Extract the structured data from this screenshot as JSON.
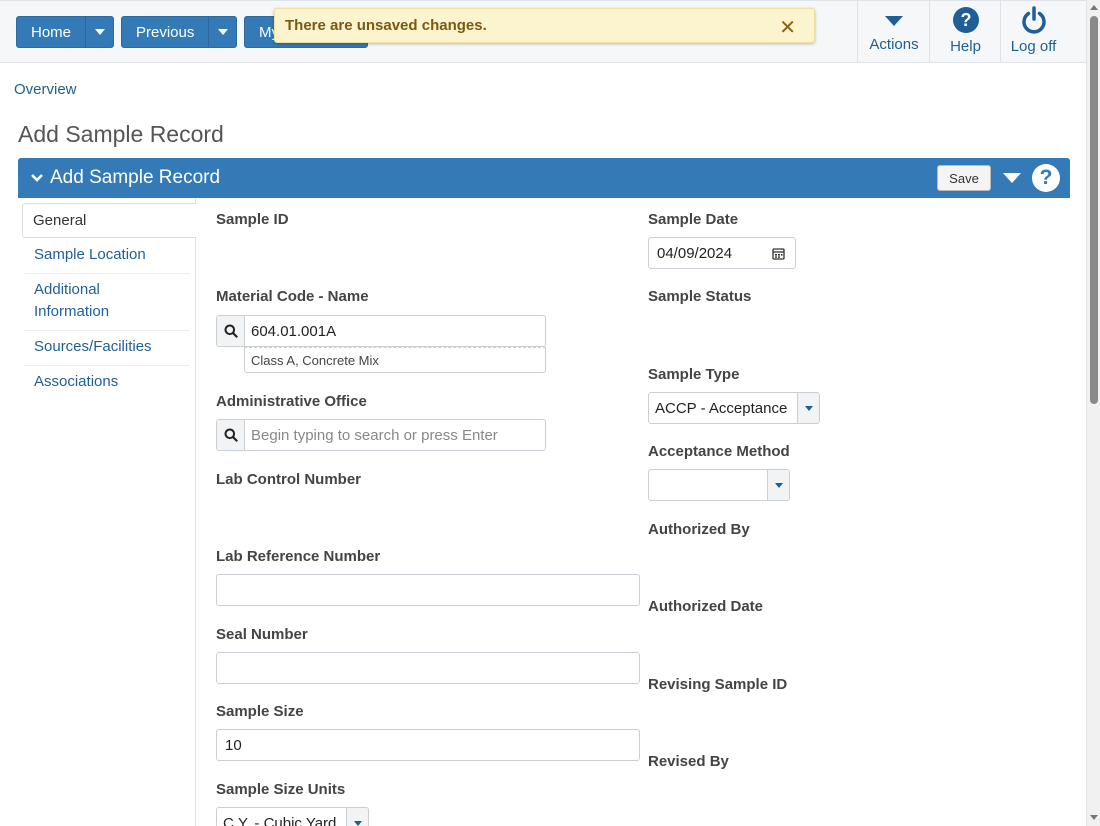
{
  "topnav": {
    "home_label": "Home",
    "previous_label": "Previous",
    "my_label": "My"
  },
  "toast": {
    "message": "There are unsaved changes.",
    "close": "✕"
  },
  "top_actions": {
    "actions_label": "Actions",
    "help_label": "Help",
    "logoff_label": "Log off"
  },
  "breadcrumb": "Overview",
  "page_title": "Add Sample Record",
  "panel": {
    "title": "Add Sample Record",
    "save_label": "Save",
    "help": "?"
  },
  "sidebar": {
    "items": [
      {
        "label": "General"
      },
      {
        "label": "Sample Location"
      },
      {
        "label": "Additional\nInformation"
      },
      {
        "label": "Sources/Facilities"
      },
      {
        "label": "Associations"
      }
    ]
  },
  "form": {
    "sample_id_label": "Sample ID",
    "material_label": "Material Code - Name",
    "material_value": "604.01.001A",
    "material_desc": "Class A, Concrete Mix",
    "admin_office_label": "Administrative Office",
    "admin_office_placeholder": "Begin typing to search or press Enter",
    "lab_control_label": "Lab Control Number",
    "lab_ref_label": "Lab Reference Number",
    "lab_ref_value": "",
    "seal_label": "Seal Number",
    "seal_value": "",
    "sample_size_label": "Sample Size",
    "sample_size_value": "10",
    "size_units_label": "Sample Size Units",
    "size_units_value": "C.Y. - Cubic Yard",
    "sample_date_label": "Sample Date",
    "sample_date_value": "04/09/2024",
    "sample_status_label": "Sample Status",
    "sample_type_label": "Sample Type",
    "sample_type_value": "ACCP - Acceptance",
    "acceptance_label": "Acceptance Method",
    "acceptance_value": "",
    "authorized_by_label": "Authorized By",
    "authorized_date_label": "Authorized Date",
    "revising_label": "Revising Sample ID",
    "revised_by_label": "Revised By"
  },
  "colors": {
    "primary": "#337ab7",
    "link": "#1f5f95",
    "toast_bg": "#fcf3cf"
  }
}
